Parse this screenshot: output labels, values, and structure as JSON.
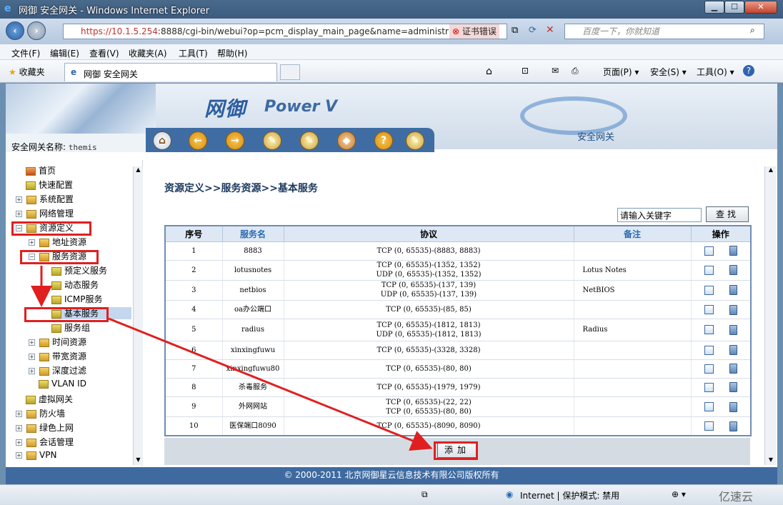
{
  "window": {
    "title": "网御 安全网关 - Windows Internet Explorer",
    "min": "▁",
    "max": "☐",
    "close": "✕"
  },
  "address": {
    "url_host": "https://10.1.5.254",
    "url_rest": ":8888/cgi-bin/webui?op=pcm_display_main_page&name=administr",
    "cert_error": "证书错误",
    "search_placeholder": "百度一下，你就知道"
  },
  "menu": [
    "文件(F)",
    "编辑(E)",
    "查看(V)",
    "收藏夹(A)",
    "工具(T)",
    "帮助(H)"
  ],
  "favorites": {
    "label": "收藏夹"
  },
  "tab": {
    "title": "网御 安全网关"
  },
  "commands": {
    "page": "页面(P) ▾",
    "safety": "安全(S) ▾",
    "tools": "工具(O) ▾",
    "help": "?"
  },
  "banner": {
    "logo": "网御",
    "product": "Power V",
    "brand": "安全网关",
    "gateway_label": "安全网关名称:",
    "gateway_name": "themis"
  },
  "toolbar": [
    "⌂",
    "←",
    "→",
    "✎",
    "✎",
    "◆",
    "?",
    "✎"
  ],
  "tree": [
    {
      "label": "首页",
      "icon": "home-icon",
      "indent": 0,
      "expander": ""
    },
    {
      "label": "快速配置",
      "icon": "wand-icon",
      "indent": 0,
      "expander": ""
    },
    {
      "label": "系统配置",
      "icon": "folder-icon",
      "indent": 0,
      "expander": "+"
    },
    {
      "label": "网络管理",
      "icon": "folder-icon",
      "indent": 0,
      "expander": "+"
    },
    {
      "label": "资源定义",
      "icon": "folder-open-icon",
      "indent": 0,
      "expander": "−"
    },
    {
      "label": "地址资源",
      "icon": "folder-icon",
      "indent": 1,
      "expander": "+"
    },
    {
      "label": "服务资源",
      "icon": "folder-open-icon",
      "indent": 1,
      "expander": "−"
    },
    {
      "label": "预定义服务",
      "icon": "wand-icon",
      "indent": 2,
      "expander": ""
    },
    {
      "label": "动态服务",
      "icon": "wand-icon",
      "indent": 2,
      "expander": ""
    },
    {
      "label": "ICMP服务",
      "icon": "wand-icon",
      "indent": 2,
      "expander": ""
    },
    {
      "label": "基本服务",
      "icon": "wand-icon",
      "indent": 2,
      "expander": ""
    },
    {
      "label": "服务组",
      "icon": "wand-icon",
      "indent": 2,
      "expander": ""
    },
    {
      "label": "时间资源",
      "icon": "folder-icon",
      "indent": 1,
      "expander": "+"
    },
    {
      "label": "带宽资源",
      "icon": "folder-icon",
      "indent": 1,
      "expander": "+"
    },
    {
      "label": "深度过滤",
      "icon": "folder-icon",
      "indent": 1,
      "expander": "+"
    },
    {
      "label": "VLAN ID",
      "icon": "wand-icon",
      "indent": 1,
      "expander": ""
    },
    {
      "label": "虚拟网关",
      "icon": "wand-icon",
      "indent": 0,
      "expander": ""
    },
    {
      "label": "防火墙",
      "icon": "folder-icon",
      "indent": 0,
      "expander": "+"
    },
    {
      "label": "绿色上网",
      "icon": "folder-icon",
      "indent": 0,
      "expander": "+"
    },
    {
      "label": "会话管理",
      "icon": "folder-icon",
      "indent": 0,
      "expander": "+"
    },
    {
      "label": "VPN",
      "icon": "folder-icon",
      "indent": 0,
      "expander": "+"
    }
  ],
  "main": {
    "breadcrumb": "资源定义>>服务资源>>基本服务",
    "keyword_placeholder": "请输入关键字",
    "find_label": "查找",
    "columns": [
      "序号",
      "服务名",
      "协议",
      "备注",
      "操作"
    ],
    "rows": [
      {
        "no": "1",
        "name": "8883",
        "protocol": [
          "TCP (0, 65535)-(8883, 8883)"
        ],
        "note": ""
      },
      {
        "no": "2",
        "name": "lotusnotes",
        "protocol": [
          "TCP (0, 65535)-(1352, 1352)",
          "UDP (0, 65535)-(1352, 1352)"
        ],
        "note": "Lotus Notes"
      },
      {
        "no": "3",
        "name": "netbios",
        "protocol": [
          "TCP (0, 65535)-(137, 139)",
          "UDP (0, 65535)-(137, 139)"
        ],
        "note": "NetBIOS"
      },
      {
        "no": "4",
        "name": "oa办公端口",
        "protocol": [
          "TCP (0, 65535)-(85, 85)"
        ],
        "note": ""
      },
      {
        "no": "5",
        "name": "radius",
        "protocol": [
          "TCP (0, 65535)-(1812, 1813)",
          "UDP (0, 65535)-(1812, 1813)"
        ],
        "note": "Radius"
      },
      {
        "no": "6",
        "name": "xinxingfuwu",
        "protocol": [
          "TCP (0, 65535)-(3328, 3328)"
        ],
        "note": ""
      },
      {
        "no": "7",
        "name": "xinxingfuwu80",
        "protocol": [
          "TCP (0, 65535)-(80, 80)"
        ],
        "note": ""
      },
      {
        "no": "8",
        "name": "杀毒服务",
        "protocol": [
          "TCP (0, 65535)-(1979, 1979)"
        ],
        "note": ""
      },
      {
        "no": "9",
        "name": "外网网站",
        "protocol": [
          "TCP (0, 65535)-(22, 22)",
          "TCP (0, 65535)-(80, 80)"
        ],
        "note": ""
      },
      {
        "no": "10",
        "name": "医保端口8090",
        "protocol": [
          "TCP (0, 65535)-(8090, 8090)"
        ],
        "note": ""
      }
    ],
    "add_label": "添加"
  },
  "footer": "© 2000-2011 北京网御星云信息技术有限公司版权所有",
  "status": {
    "zone": "Internet | 保护模式: 禁用",
    "watermark": "亿速云"
  },
  "colors": {
    "highlight": "#e02020",
    "header_blue": "#3e6aa0"
  }
}
